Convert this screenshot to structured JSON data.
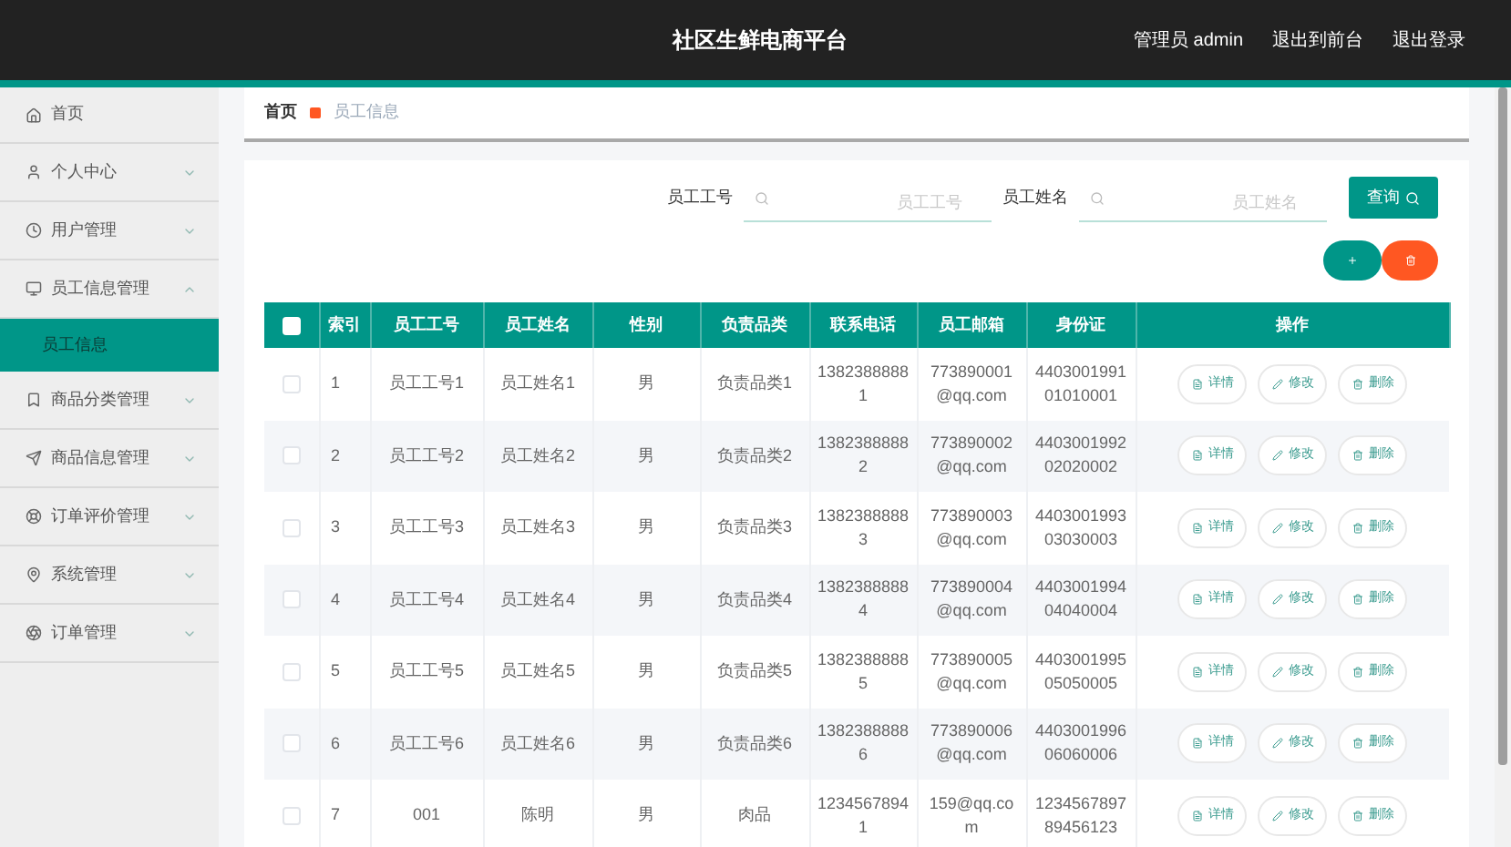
{
  "header": {
    "title": "社区生鲜电商平台",
    "links": [
      "管理员 admin",
      "退出到前台",
      "退出登录"
    ]
  },
  "sidebar": {
    "items": [
      {
        "label": "首页"
      },
      {
        "label": "个人中心",
        "expanded": false
      },
      {
        "label": "用户管理",
        "expanded": false
      },
      {
        "label": "员工信息管理",
        "expanded": true,
        "children": [
          {
            "label": "员工信息",
            "selected": true
          }
        ]
      },
      {
        "label": "商品分类管理",
        "expanded": false
      },
      {
        "label": "商品信息管理",
        "expanded": false
      },
      {
        "label": "订单评价管理",
        "expanded": false
      },
      {
        "label": "系统管理",
        "expanded": false
      },
      {
        "label": "订单管理",
        "expanded": false
      }
    ]
  },
  "breadcrumb": [
    "首页",
    "员工信息"
  ],
  "search": {
    "fields": [
      {
        "label": "员工工号",
        "placeholder": "员工工号"
      },
      {
        "label": "员工姓名",
        "placeholder": "员工姓名"
      }
    ],
    "button": "查询"
  },
  "table": {
    "select_all": {
      "checked": false
    },
    "columns": [
      "索引",
      "员工工号",
      "员工姓名",
      "性别",
      "负责品类",
      "联系电话",
      "员工邮箱",
      "身份证",
      "操作"
    ],
    "rows": [
      {
        "checked": false,
        "actions": [
          "详情",
          "修改",
          "删除"
        ],
        "cells": [
          "1",
          "员工工号1",
          "员工姓名1",
          "男",
          "负责品类1",
          "13823888881",
          "773890001@qq.com",
          "440300199101010001"
        ]
      },
      {
        "checked": false,
        "actions": [
          "详情",
          "修改",
          "删除"
        ],
        "cells": [
          "2",
          "员工工号2",
          "员工姓名2",
          "男",
          "负责品类2",
          "13823888882",
          "773890002@qq.com",
          "440300199202020002"
        ]
      },
      {
        "checked": false,
        "actions": [
          "详情",
          "修改",
          "删除"
        ],
        "cells": [
          "3",
          "员工工号3",
          "员工姓名3",
          "男",
          "负责品类3",
          "13823888883",
          "773890003@qq.com",
          "440300199303030003"
        ]
      },
      {
        "checked": false,
        "actions": [
          "详情",
          "修改",
          "删除"
        ],
        "cells": [
          "4",
          "员工工号4",
          "员工姓名4",
          "男",
          "负责品类4",
          "13823888884",
          "773890004@qq.com",
          "440300199404040004"
        ]
      },
      {
        "checked": false,
        "actions": [
          "详情",
          "修改",
          "删除"
        ],
        "cells": [
          "5",
          "员工工号5",
          "员工姓名5",
          "男",
          "负责品类5",
          "13823888885",
          "773890005@qq.com",
          "440300199505050005"
        ]
      },
      {
        "checked": false,
        "actions": [
          "详情",
          "修改",
          "删除"
        ],
        "cells": [
          "6",
          "员工工号6",
          "员工姓名6",
          "男",
          "负责品类6",
          "13823888886",
          "773890006@qq.com",
          "440300199606060006"
        ]
      },
      {
        "checked": false,
        "actions": [
          "详情",
          "修改",
          "删除"
        ],
        "cells": [
          "7",
          "001",
          "陈明",
          "男",
          "肉品",
          "12345678941",
          "159@qq.com",
          "123456789789456123"
        ]
      }
    ]
  }
}
